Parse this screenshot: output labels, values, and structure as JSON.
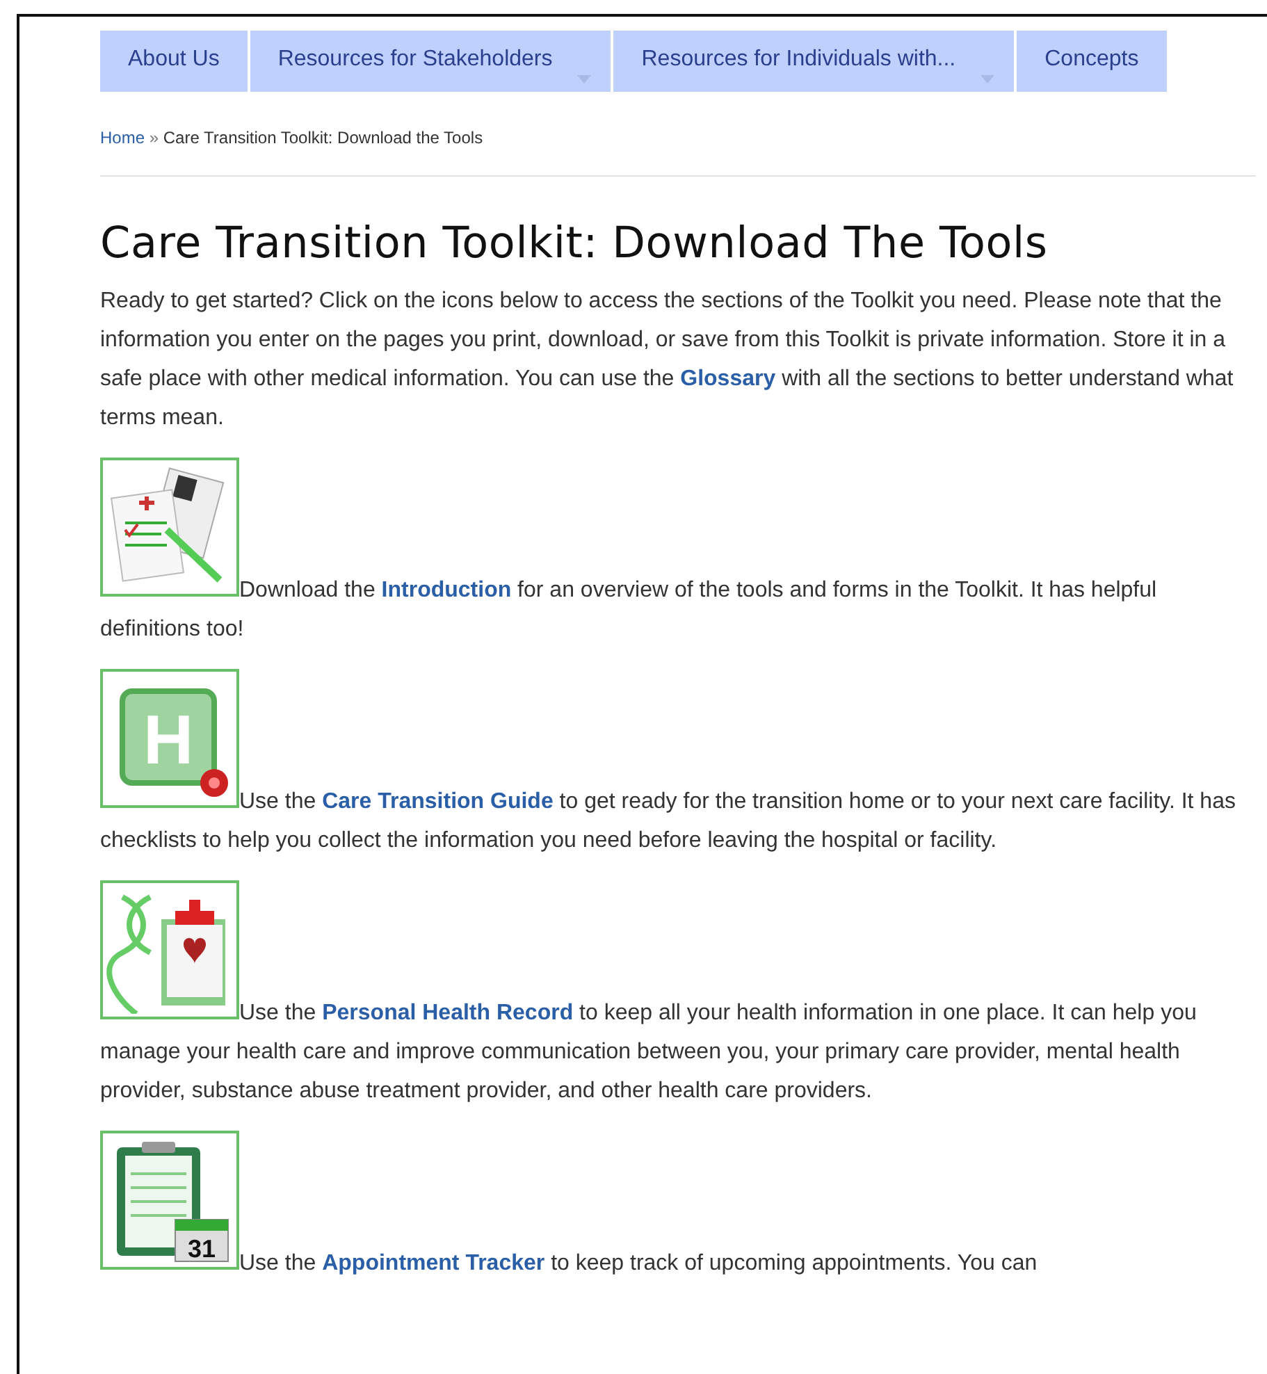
{
  "nav": [
    {
      "label": "About Us",
      "has_menu": false
    },
    {
      "label": "Resources for Stakeholders",
      "has_menu": true
    },
    {
      "label": "Resources for Individuals with...",
      "has_menu": true
    },
    {
      "label": "Concepts",
      "has_menu": false
    }
  ],
  "breadcrumb": {
    "home": "Home",
    "separator": "»",
    "current": "Care Transition Toolkit: Download the Tools"
  },
  "title": "Care Transition Toolkit: Download The Tools",
  "intro": {
    "before": "Ready to get started? Click on the icons below to access the sections of the Toolkit you need. Please note that the information you enter on the pages you print, download, or save from this Toolkit is private information. Store it in a safe place with other medical information. You can use the",
    "link": "Glossary",
    "after": "with all the sections to better understand what terms mean."
  },
  "sections": [
    {
      "kind": "forms",
      "before": "Download the",
      "link": "Introduction",
      "after": "for an overview of the tools and forms in the Toolkit. It has helpful definitions too!"
    },
    {
      "kind": "hospital",
      "icon_text": "H",
      "before": "Use the",
      "link": "Care Transition Guide",
      "after": "to get ready for the transition home or to your next care facility. It has checklists to help you collect the information you need before leaving the hospital or facility."
    },
    {
      "kind": "record",
      "before": "Use the",
      "link": "Personal Health Record",
      "after": "to keep all your health information in one place. It can help you manage your health care and improve communication between you, your primary care provider, mental health provider, substance abuse treatment provider, and other health care providers."
    },
    {
      "kind": "tracker",
      "icon_text": "31",
      "before": "Use the",
      "link": "Appointment Tracker",
      "after": "to keep track of upcoming appointments.  You can"
    }
  ]
}
